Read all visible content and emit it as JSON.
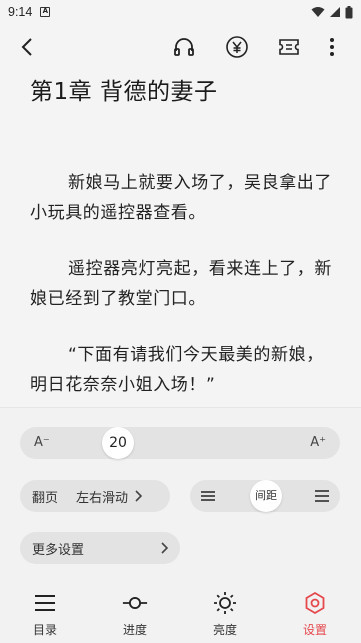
{
  "status_bar": {
    "time": "9:14",
    "notification_badge": "A"
  },
  "reader": {
    "chapter_title": "第1章 背德的妻子",
    "paragraphs": [
      "新娘马上就要入场了，吴良拿出了小玩具的遥控器查看。",
      "遥控器亮灯亮起，看来连上了，新娘已经到了教堂门口。",
      "“下面有请我们今天最美的新娘，明日花奈奈小姐入场！”"
    ]
  },
  "settings": {
    "font_size": {
      "decrease_label": "A⁻",
      "value": "20",
      "increase_label": "A⁺"
    },
    "page_turn": {
      "label": "翻页",
      "value": "左右滑动"
    },
    "line_spacing": {
      "label": "间距"
    },
    "more_settings": {
      "label": "更多设置"
    }
  },
  "bottom_nav": {
    "items": [
      {
        "label": "目录",
        "icon": "menu-icon"
      },
      {
        "label": "进度",
        "icon": "progress-icon"
      },
      {
        "label": "亮度",
        "icon": "sun-icon"
      },
      {
        "label": "设置",
        "icon": "settings-icon"
      }
    ],
    "active_index": 3
  },
  "colors": {
    "accent": "#e5484d",
    "panel_bg": "#f2f2f2",
    "page_bg": "#f4f4f4"
  }
}
